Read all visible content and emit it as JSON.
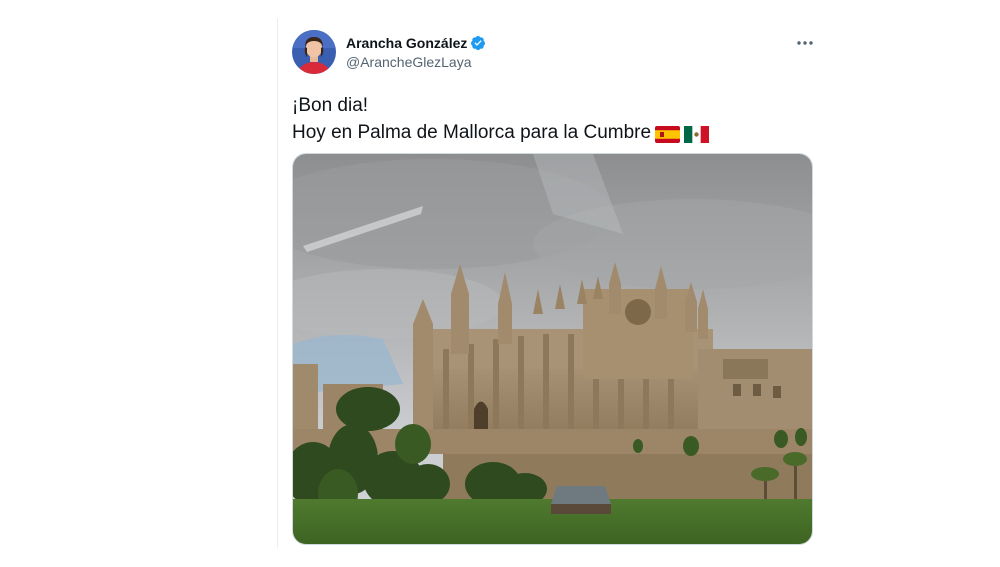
{
  "tweet": {
    "author": {
      "display_name": "Arancha González",
      "handle": "@ArancheGlezLaya",
      "verified": true,
      "avatar_icon": "profile-photo"
    },
    "text_line_1": "¡Bon dia!",
    "text_line_2": "Hoy en Palma de Mallorca para la Cumbre",
    "flags": [
      "spain-flag-emoji",
      "mexico-flag-emoji"
    ],
    "more_icon": "more-options-icon",
    "media": {
      "type": "photo",
      "subject": "palma-cathedral-photo"
    }
  },
  "colors": {
    "verified_blue": "#1d9bf0",
    "text": "#0f1419",
    "secondary_text": "#536471"
  }
}
